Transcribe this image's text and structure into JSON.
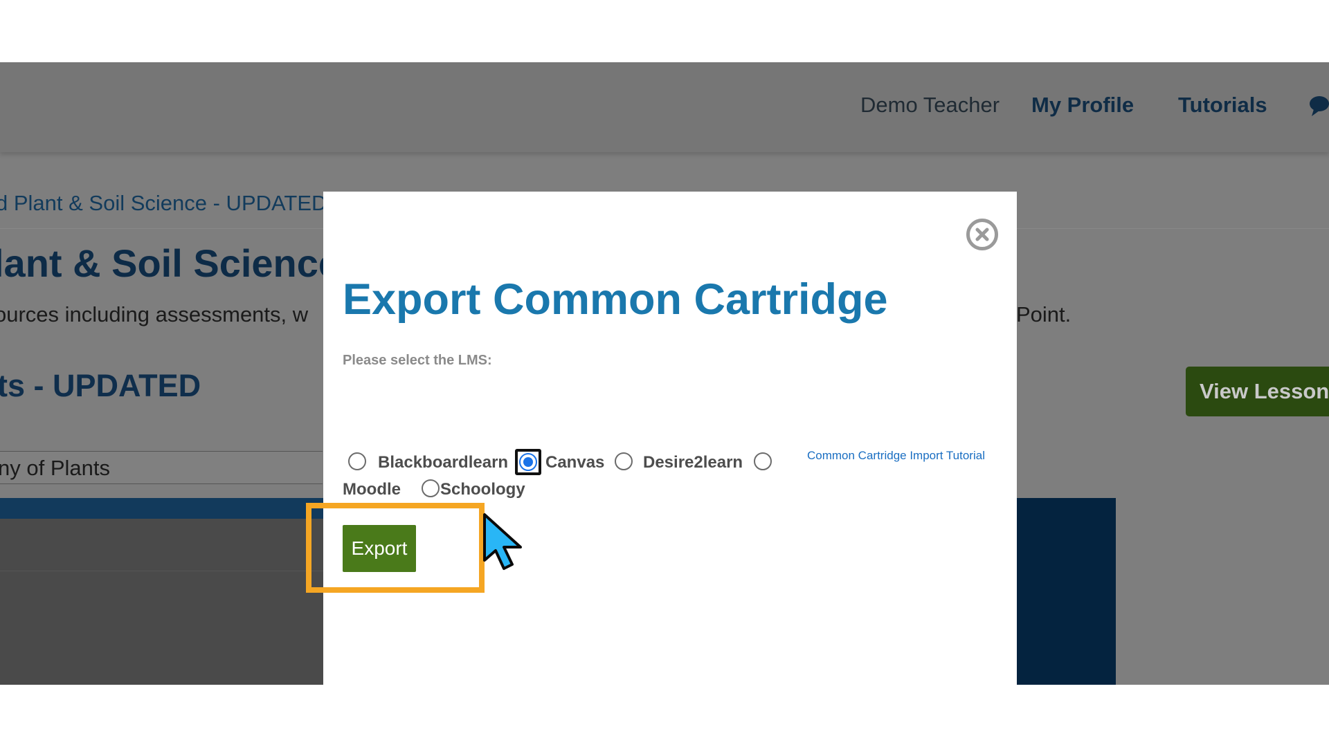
{
  "header": {
    "user_name": "Demo Teacher",
    "profile_link": "My Profile",
    "tutorials_link": "Tutorials",
    "chat_icon": "chat-icon"
  },
  "background": {
    "breadcrumb": "d Plant & Soil Science - UPDATED",
    "course_title": "lant & Soil Science",
    "description_left": "ources including assessments, w",
    "description_right": "Point.",
    "lesson_title": "ts - UPDATED",
    "lesson_select": "ny of Plants",
    "view_lesson_button": "View Lesson",
    "accent_colors": {
      "navy": "#0d2b47",
      "dark_green": "#2b4a10"
    }
  },
  "modal": {
    "title": "Export Common Cartridge",
    "prompt": "Please select the LMS:",
    "lms_options": [
      {
        "label": "Blackboardlearn",
        "selected": false
      },
      {
        "label": "Canvas",
        "selected": true
      },
      {
        "label": "Desire2learn",
        "selected": false
      },
      {
        "label": "Moodle",
        "selected": false
      },
      {
        "label": "Schoology",
        "selected": false
      }
    ],
    "tutorial_link": "Common Cartridge Import Tutorial",
    "export_button": "Export",
    "close_icon": "close-icon",
    "colors": {
      "title": "#1a78ad",
      "export_button": "#4a7a1a",
      "highlight": "#f5a623",
      "cursor": "#29b6f6"
    }
  }
}
